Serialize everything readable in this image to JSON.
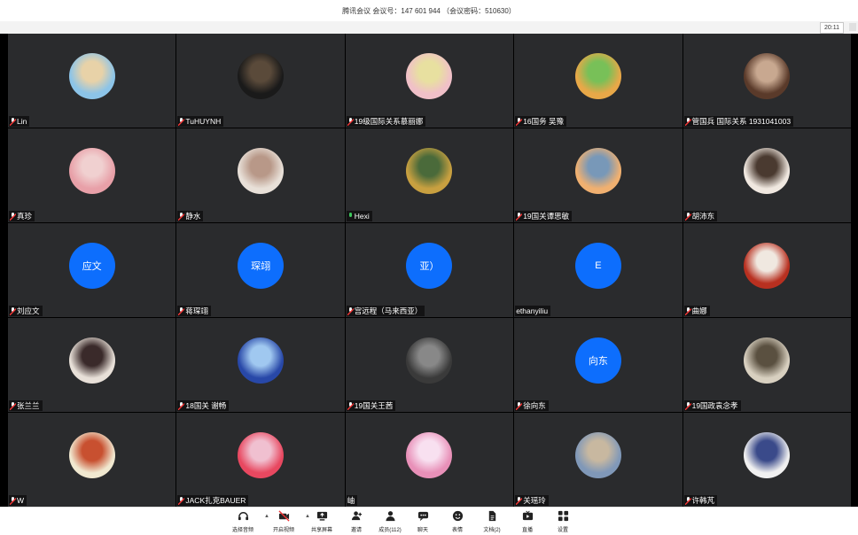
{
  "window": {
    "title": "腾讯会议 会议号：147 601 944 （会议密码：510630）",
    "clock": "20:11"
  },
  "participants": [
    {
      "name": "Lin",
      "mic": "muted",
      "avatar": "photo-beach",
      "colors": [
        "#8cc4e8",
        "#e8d2a8"
      ]
    },
    {
      "name": "TuHUYNH",
      "mic": "muted",
      "avatar": "photo-dark",
      "colors": [
        "#1a1a1a",
        "#5a4a3a"
      ]
    },
    {
      "name": "19级国际关系慕丽娜",
      "mic": "muted",
      "avatar": "photo-child",
      "colors": [
        "#f0c0c8",
        "#e8e0a0"
      ]
    },
    {
      "name": "16国务 吴豫",
      "mic": "muted",
      "avatar": "photo-cartoon",
      "colors": [
        "#e8a848",
        "#78c058"
      ]
    },
    {
      "name": "管国兵 国际关系 1931041003",
      "mic": "muted",
      "avatar": "photo-portrait",
      "colors": [
        "#5a3a2a",
        "#c8a890"
      ]
    },
    {
      "name": "真珍",
      "mic": "muted",
      "avatar": "photo-bear",
      "colors": [
        "#e8a0a8",
        "#f0d0d0"
      ]
    },
    {
      "name": "静水",
      "mic": "muted",
      "avatar": "photo-baby",
      "colors": [
        "#e8e0d8",
        "#b89888"
      ]
    },
    {
      "name": "Hexi",
      "mic": "on",
      "avatar": "photo-aerial",
      "colors": [
        "#c8a040",
        "#4a6a3a"
      ]
    },
    {
      "name": "19国关谭思敏",
      "mic": "muted",
      "avatar": "photo-sunset",
      "colors": [
        "#f0b070",
        "#7898b8"
      ]
    },
    {
      "name": "胡沛东",
      "mic": "muted",
      "avatar": "photo-portrait2",
      "colors": [
        "#f0e8e0",
        "#4a3a30"
      ]
    },
    {
      "name": "刘应文",
      "mic": "muted",
      "initials": "应文"
    },
    {
      "name": "蒋琛翊",
      "mic": "muted",
      "initials": "琛翊"
    },
    {
      "name": "宫远程（马来西亚）",
      "mic": "muted",
      "initials": "亚）"
    },
    {
      "name": "ethanyiliu",
      "mic": "none",
      "initials": "E"
    },
    {
      "name": "曲娜",
      "mic": "muted",
      "avatar": "photo-temple",
      "colors": [
        "#b83020",
        "#f0e8e0"
      ]
    },
    {
      "name": "张兰兰",
      "mic": "muted",
      "avatar": "photo-girl",
      "colors": [
        "#e8e0d8",
        "#3a2a2a"
      ]
    },
    {
      "name": "18国关 谢畅",
      "mic": "muted",
      "avatar": "photo-silhouette",
      "colors": [
        "#2848a8",
        "#a0c8f0"
      ]
    },
    {
      "name": "19国关王茜",
      "mic": "muted",
      "avatar": "photo-motion",
      "colors": [
        "#3a3a3a",
        "#888888"
      ]
    },
    {
      "name": "徐向东",
      "mic": "muted",
      "initials": "向东"
    },
    {
      "name": "19国政袁念孝",
      "mic": "muted",
      "avatar": "photo-statue",
      "colors": [
        "#d8d0c0",
        "#5a5040"
      ]
    },
    {
      "name": "W",
      "mic": "muted",
      "avatar": "photo-kremlin",
      "colors": [
        "#f0e8d0",
        "#c85030"
      ]
    },
    {
      "name": "JACK扎克BAUER",
      "mic": "muted",
      "avatar": "photo-stage",
      "colors": [
        "#e84860",
        "#f0c0d0"
      ]
    },
    {
      "name": "岫",
      "mic": "none",
      "avatar": "photo-doll",
      "colors": [
        "#e890b8",
        "#f8e0f0"
      ]
    },
    {
      "name": "关瑶玲",
      "mic": "muted",
      "avatar": "photo-city",
      "colors": [
        "#8098b8",
        "#c8b8a0"
      ]
    },
    {
      "name": "许韩芃",
      "mic": "muted",
      "avatar": "photo-anime",
      "colors": [
        "#f0f0f0",
        "#3a4a8a"
      ]
    }
  ],
  "toolbar": [
    {
      "id": "audio",
      "label": "选择音频",
      "icon": "headset-icon",
      "caret": true
    },
    {
      "id": "video",
      "label": "开启视频",
      "icon": "camera-off-icon",
      "caret": true
    },
    {
      "id": "share",
      "label": "共享屏幕",
      "icon": "share-screen-icon"
    },
    {
      "id": "invite",
      "label": "邀请",
      "icon": "add-person-icon"
    },
    {
      "id": "members",
      "label": "成员(112)",
      "icon": "members-icon"
    },
    {
      "id": "chat",
      "label": "聊天",
      "icon": "chat-icon"
    },
    {
      "id": "reaction",
      "label": "表情",
      "icon": "smile-icon"
    },
    {
      "id": "docs",
      "label": "文档(2)",
      "icon": "document-icon"
    },
    {
      "id": "live",
      "label": "直播",
      "icon": "live-icon"
    },
    {
      "id": "settings",
      "label": "设置",
      "icon": "apps-icon"
    }
  ]
}
